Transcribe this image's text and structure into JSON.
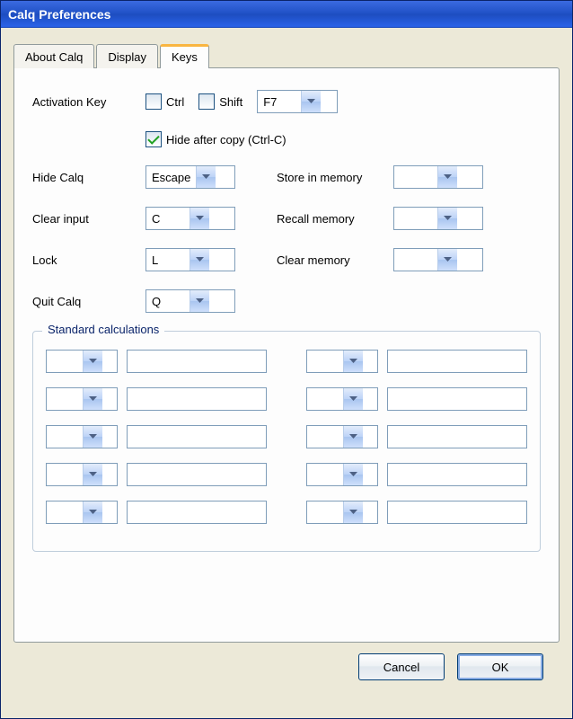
{
  "window": {
    "title": "Calq Preferences"
  },
  "tabs": {
    "about": "About Calq",
    "display": "Display",
    "keys": "Keys"
  },
  "activation": {
    "label": "Activation Key",
    "ctrl_label": "Ctrl",
    "ctrl_checked": false,
    "shift_label": "Shift",
    "shift_checked": false,
    "key": "F7"
  },
  "hide_after_copy": {
    "label": "Hide after copy (Ctrl-C)",
    "checked": true
  },
  "shortcuts": {
    "hide_calq": {
      "label": "Hide Calq",
      "value": "Escape"
    },
    "clear_input": {
      "label": "Clear input",
      "value": "C"
    },
    "lock": {
      "label": "Lock",
      "value": "L"
    },
    "quit_calq": {
      "label": "Quit Calq",
      "value": "Q"
    },
    "store_mem": {
      "label": "Store in memory",
      "value": ""
    },
    "recall_mem": {
      "label": "Recall memory",
      "value": ""
    },
    "clear_mem": {
      "label": "Clear memory",
      "value": ""
    }
  },
  "standard_calc": {
    "legend": "Standard calculations",
    "rows": [
      {
        "left_key": "",
        "left_expr": "",
        "right_key": "",
        "right_expr": ""
      },
      {
        "left_key": "",
        "left_expr": "",
        "right_key": "",
        "right_expr": ""
      },
      {
        "left_key": "",
        "left_expr": "",
        "right_key": "",
        "right_expr": ""
      },
      {
        "left_key": "",
        "left_expr": "",
        "right_key": "",
        "right_expr": ""
      },
      {
        "left_key": "",
        "left_expr": "",
        "right_key": "",
        "right_expr": ""
      }
    ]
  },
  "buttons": {
    "cancel": "Cancel",
    "ok": "OK"
  }
}
